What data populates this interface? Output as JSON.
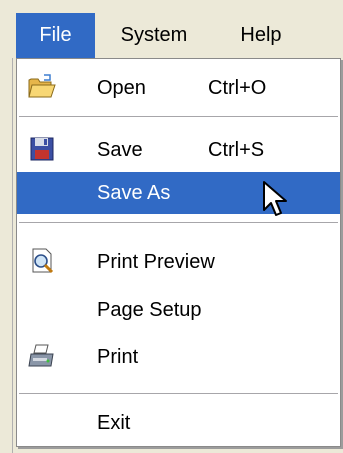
{
  "menubar": {
    "items": [
      {
        "label": "File"
      },
      {
        "label": "System"
      },
      {
        "label": "Help"
      }
    ]
  },
  "file_menu": {
    "open": {
      "label": "Open",
      "shortcut": "Ctrl+O"
    },
    "save": {
      "label": "Save",
      "shortcut": "Ctrl+S"
    },
    "save_as": {
      "label": "Save As"
    },
    "print_preview": {
      "label": "Print Preview"
    },
    "page_setup": {
      "label": "Page Setup"
    },
    "print": {
      "label": "Print"
    },
    "exit": {
      "label": "Exit"
    }
  },
  "colors": {
    "highlight": "#316ac5",
    "menu_background": "#ffffff",
    "bar_background": "#ece9d8"
  },
  "icons": {
    "open": "folder-open-icon",
    "save": "floppy-disk-icon",
    "print_preview": "print-preview-icon",
    "print": "printer-icon",
    "cursor": "mouse-pointer-icon"
  }
}
